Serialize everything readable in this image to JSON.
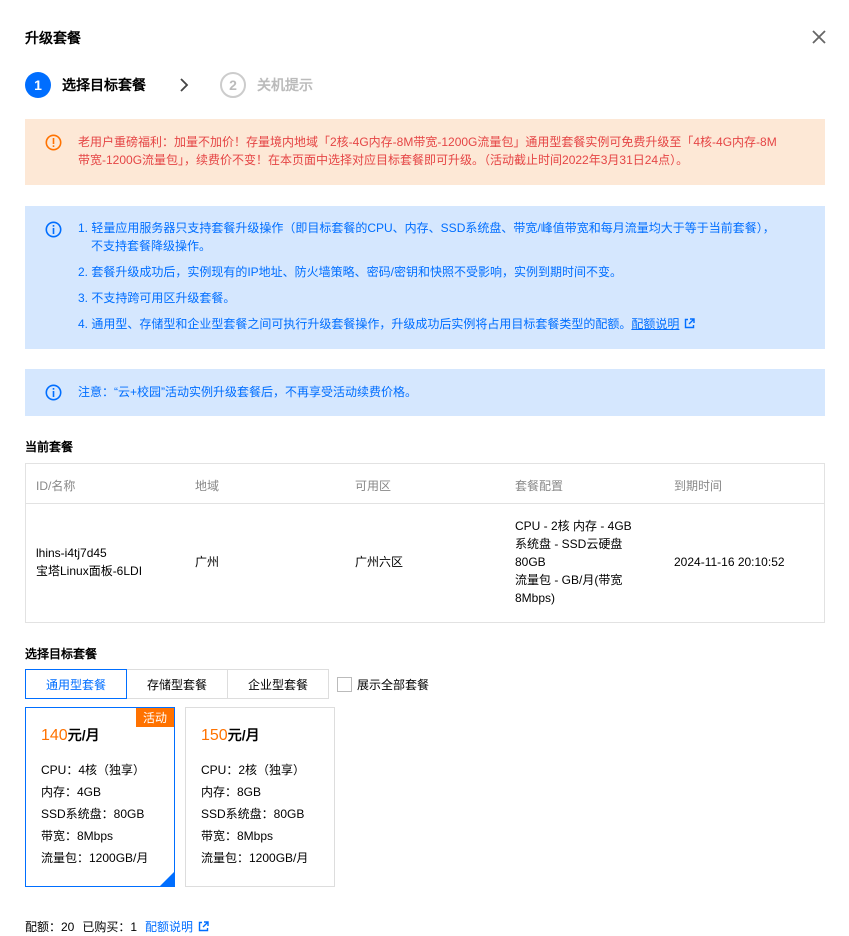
{
  "dialog": {
    "title": "升级套餐"
  },
  "steps": [
    {
      "num": "1",
      "label": "选择目标套餐"
    },
    {
      "num": "2",
      "label": "关机提示"
    }
  ],
  "alert_warn": {
    "line1": "老用户重磅福利：加量不加价！存量境内地域「2核-4G内存-8M带宽-1200G流量包」通用型套餐实例可免费升级至「4核-4G内存-8M",
    "line2": "带宽-1200G流量包」，续费价不变！在本页面中选择对应目标套餐即可升级。（活动截止时间2022年3月31日24点）。"
  },
  "alert_info": {
    "item1_a": "1. 轻量应用服务器只支持套餐升级操作（即目标套餐的CPU、内存、SSD系统盘、带宽/峰值带宽和每月流量均大于等于当前套餐），",
    "item1_b": "不支持套餐降级操作。",
    "item2": "2. 套餐升级成功后，实例现有的IP地址、防火墙策略、密码/密钥和快照不受影响，实例到期时间不变。",
    "item3": "3. 不支持跨可用区升级套餐。",
    "item4": "4. 通用型、存储型和企业型套餐之间可执行升级套餐操作，升级成功后实例将占用目标套餐类型的配额。",
    "item4_link": "配额说明"
  },
  "alert_note": {
    "text": "注意：“云+校园”活动实例升级套餐后，不再享受活动续费价格。"
  },
  "current": {
    "title": "当前套餐",
    "headers": [
      "ID/名称",
      "地域",
      "可用区",
      "套餐配置",
      "到期时间"
    ],
    "id": "lhins-i4tj7d45",
    "name": "宝塔Linux面板-6LDI",
    "region": "广州",
    "zone": "广州六区",
    "config": [
      "CPU - 2核 内存 - 4GB",
      "系统盘 - SSD云硬盘",
      "80GB",
      "流量包 - GB/月(带宽",
      "8Mbps)"
    ],
    "expire": "2024-11-16 20:10:52"
  },
  "target": {
    "title": "选择目标套餐",
    "tabs": [
      "通用型套餐",
      "存储型套餐",
      "企业型套餐"
    ],
    "show_all": "展示全部套餐",
    "cards": [
      {
        "price": "140",
        "unit": "元/月",
        "badge": "活动",
        "specs": [
          "CPU：4核（独享）",
          "内存：4GB",
          "SSD系统盘：80GB",
          "带宽：8Mbps",
          "流量包：1200GB/月"
        ]
      },
      {
        "price": "150",
        "unit": "元/月",
        "specs": [
          "CPU：2核（独享）",
          "内存：8GB",
          "SSD系统盘：80GB",
          "带宽：8Mbps",
          "流量包：1200GB/月"
        ]
      }
    ]
  },
  "footer": {
    "quota": "配额：20",
    "bought": "已购买：1",
    "link": "配额说明"
  },
  "colors": {
    "primary": "#006eff",
    "warn_bg": "#fde8d6",
    "warn_text": "#e54545",
    "info_bg": "#d5e7fe",
    "price": "#ff7200"
  }
}
